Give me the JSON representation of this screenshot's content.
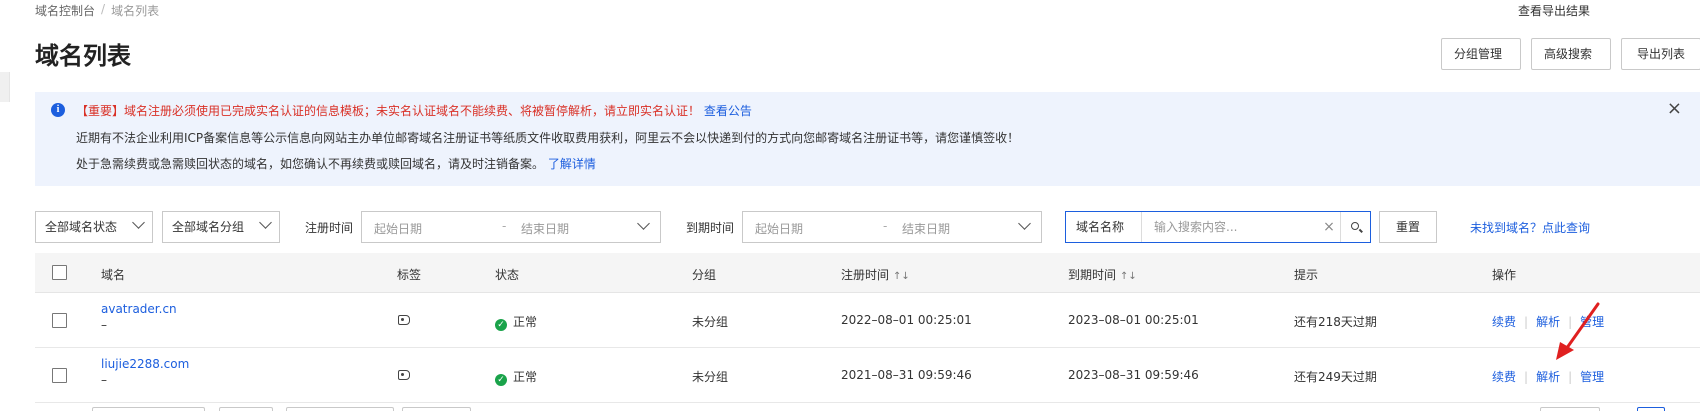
{
  "breadcrumb": {
    "root": "域名控制台",
    "separator": "/",
    "current": "域名列表"
  },
  "header": {
    "export_result": "查看导出结果",
    "title": "域名列表"
  },
  "actions": {
    "group_manage": "分组管理",
    "advanced_search": "高级搜索",
    "export_list": "导出列表"
  },
  "notice": {
    "line1_warning": "【重要】域名注册必须使用已完成实名认证的信息模板；未实名认证域名不能续费、将被暂停解析，请立即实名认证！",
    "line1_link": "查看公告",
    "line2": "近期有不法企业利用ICP备案信息等公示信息向网站主办单位邮寄域名注册证书等纸质文件收取费用获利，阿里云不会以快递到付的方式向您邮寄域名注册证书等，请您谨慎签收！",
    "line3": "处于急需续费或急需赎回状态的域名，如您确认不再续费或赎回域名，请及时注销备案。",
    "line3_link": "了解详情",
    "close_icon": "close-icon"
  },
  "filters": {
    "status": "全部域名状态",
    "group": "全部域名分组",
    "reg_label": "注册时间",
    "exp_label": "到期时间",
    "start_placeholder": "起始日期",
    "range_sep": "-",
    "end_placeholder": "结束日期",
    "search_kind": "域名名称",
    "search_placeholder": "输入搜索内容...",
    "clear": "×",
    "reset": "重置",
    "not_found": "未找到域名？点此查询"
  },
  "table": {
    "columns": {
      "domain": "域名",
      "tag": "标签",
      "status": "状态",
      "group": "分组",
      "reg_time": "注册时间",
      "exp_time": "到期时间",
      "tip": "提示",
      "ops": "操作"
    },
    "sort_icon": "↑↓",
    "rows": [
      {
        "domain": "avatrader.cn",
        "sub": "–",
        "status": "正常",
        "group": "未分组",
        "reg_time": "2022–08–01 00:25:01",
        "exp_time": "2023–08–01 00:25:01",
        "tip": "还有218天过期",
        "op_renew": "续费",
        "op_dns": "解析",
        "op_manage": "管理"
      },
      {
        "domain": "liujie2288.com",
        "sub": "–",
        "status": "正常",
        "group": "未分组",
        "reg_time": "2021–08–31 09:59:46",
        "exp_time": "2023–08–31 09:59:46",
        "tip": "还有249天过期",
        "op_renew": "续费",
        "op_dns": "解析",
        "op_manage": "管理"
      }
    ]
  },
  "colors": {
    "accent": "#1c5ede",
    "warning": "#d93026",
    "success": "#1aa34a",
    "annotation_arrow": "#e02020"
  }
}
